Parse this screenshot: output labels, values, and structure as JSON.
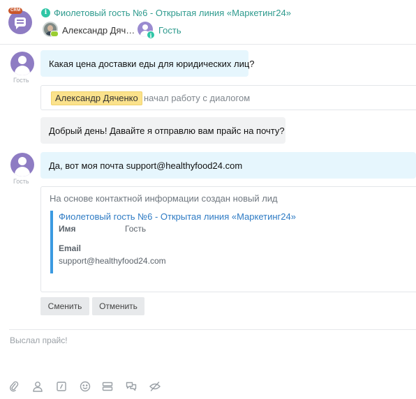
{
  "header": {
    "crm_badge": "CRM",
    "title": "Фиолетовый гость №6 - Открытая линия «Маркетинг24»",
    "operator_name": "Александр Дяч…",
    "guest_label": "Гость"
  },
  "messages": [
    {
      "type": "client",
      "text": "Какая цена доставки еды для юридических лиц?",
      "avatar_caption": "Гость"
    },
    {
      "type": "system",
      "operator": "Александр Дяченко",
      "text": "начал работу с диалогом"
    },
    {
      "type": "operator",
      "text": "Добрый день! Давайте я отправлю вам прайс на почту?"
    },
    {
      "type": "client",
      "text": "Да, вот моя почта support@healthyfood24.com",
      "avatar_caption": "Гость"
    }
  ],
  "lead_card": {
    "heading": "На основе контактной информации создан новый лид",
    "title": "Фиолетовый гость №6 - Открытая линия «Маркетинг24»",
    "name_label": "Имя",
    "name_value": "Гость",
    "email_label": "Email",
    "email_value": "support@healthyfood24.com",
    "buttons": {
      "change": "Сменить",
      "cancel": "Отменить"
    }
  },
  "composer": {
    "text": "Выслал прайс!"
  },
  "toolbar": {
    "icons": [
      "paperclip-icon",
      "user-icon",
      "quick-answer-icon",
      "smile-icon",
      "forms-icon",
      "chat-icon",
      "hidden-message-icon"
    ]
  },
  "colors": {
    "accent_teal": "#2d9a8d",
    "avatar_purple": "#8e7cc3",
    "client_bubble": "#e6f6fd",
    "operator_bubble": "#f1f2f3",
    "lead_bar": "#3b9ae1",
    "operator_tag": "#fbe28c"
  }
}
